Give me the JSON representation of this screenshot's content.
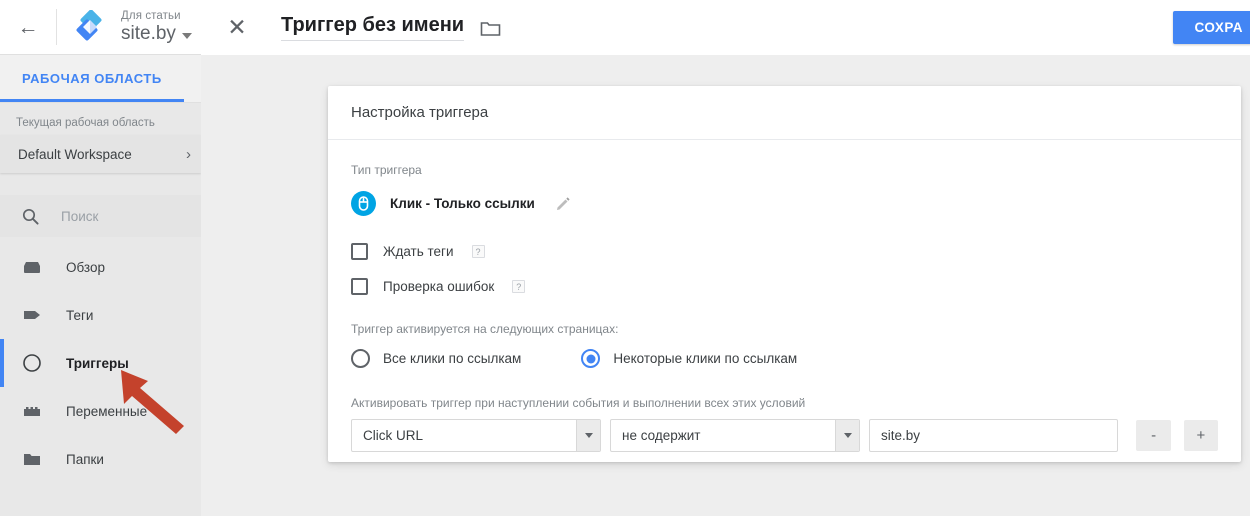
{
  "topbar": {
    "back_icon": "back-arrow-icon",
    "logo_icon": "gtm-logo-icon",
    "account_label": "Для статьи",
    "container_name": "site.by",
    "dropdown_icon": "chevron-down-icon"
  },
  "tabs": [
    {
      "label": "РАБОЧАЯ ОБЛАСТЬ",
      "active": true
    },
    {
      "label": "",
      "active": false
    }
  ],
  "sidebar": {
    "workspace_section_label": "Текущая рабочая область",
    "workspace_name": "Default Workspace",
    "workspace_chevron": "chevron-right-icon",
    "search_placeholder": "Поиск",
    "search_icon": "search-icon",
    "items": [
      {
        "label": "Обзор",
        "icon": "overview-icon",
        "active": false
      },
      {
        "label": "Теги",
        "icon": "tag-icon",
        "active": false
      },
      {
        "label": "Триггеры",
        "icon": "trigger-icon",
        "active": true
      },
      {
        "label": "Переменные",
        "icon": "variables-icon",
        "active": false
      },
      {
        "label": "Папки",
        "icon": "folder-icon",
        "active": false
      }
    ]
  },
  "overlay": {
    "close_icon": "close-icon",
    "title": "Триггер без имени",
    "folder_icon": "folder-icon",
    "save_label": "СОХРА"
  },
  "card": {
    "header_title": "Настройка триггера",
    "trigger_type_label": "Тип триггера",
    "trigger_type_name": "Клик - Только ссылки",
    "trigger_type_icon": "mouse-click-icon",
    "edit_icon": "pencil-icon",
    "checkboxes": [
      {
        "label": "Ждать теги",
        "checked": false,
        "help": "?"
      },
      {
        "label": "Проверка ошибок",
        "checked": false,
        "help": "?"
      }
    ],
    "fire_on_label": "Триггер активируется на следующих страницах:",
    "radios": [
      {
        "label": "Все клики по ссылкам",
        "checked": false
      },
      {
        "label": "Некоторые клики по ссылкам",
        "checked": true
      }
    ],
    "condition_label": "Активировать триггер при наступлении события и выполнении всех этих условий",
    "condition": {
      "variable": "Click URL",
      "operator": "не содержит",
      "value": "site.by",
      "value_placeholder": "",
      "remove_label": "-",
      "add_label": "+"
    }
  },
  "annotation": {
    "arrow_icon": "red-arrow-pointer",
    "arrow_color": "#C4422C"
  },
  "colors": {
    "accent": "#4285f4",
    "trigger_icon": "#00a4e4",
    "panel_bg": "#eeeeee",
    "sidebar_bg": "#e8e8e8"
  }
}
